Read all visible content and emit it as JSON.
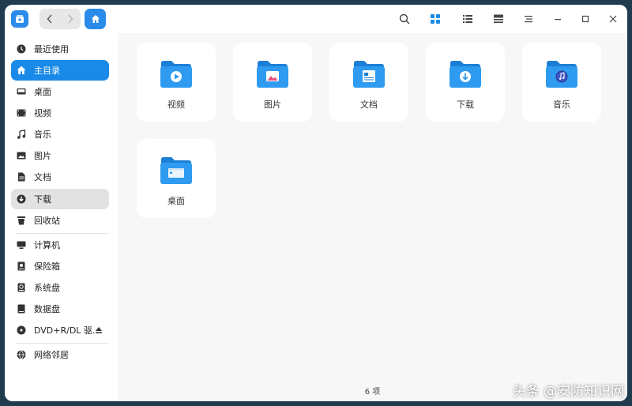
{
  "titlebar": {
    "icons": [
      "back-icon",
      "forward-icon",
      "home-icon",
      "search-icon",
      "icon-view-icon",
      "list-view-icon",
      "detail-view-icon",
      "menu-icon",
      "minimize-icon",
      "maximize-icon",
      "close-icon"
    ]
  },
  "sidebar": {
    "items": [
      {
        "label": "最近使用",
        "icon": "clock-icon"
      },
      {
        "label": "主目录",
        "icon": "home-icon"
      },
      {
        "label": "桌面",
        "icon": "desktop-icon"
      },
      {
        "label": "视频",
        "icon": "video-icon"
      },
      {
        "label": "音乐",
        "icon": "music-icon"
      },
      {
        "label": "图片",
        "icon": "picture-icon"
      },
      {
        "label": "文档",
        "icon": "document-icon"
      },
      {
        "label": "下载",
        "icon": "download-icon"
      },
      {
        "label": "回收站",
        "icon": "trash-icon"
      },
      {
        "label": "计算机",
        "icon": "computer-icon"
      },
      {
        "label": "保险箱",
        "icon": "vault-icon"
      },
      {
        "label": "系统盘",
        "icon": "disk-icon"
      },
      {
        "label": "数据盘",
        "icon": "disk-icon"
      },
      {
        "label": "DVD+R/DL 驱…",
        "icon": "optical-drive-icon"
      },
      {
        "label": "网络邻居",
        "icon": "network-icon"
      }
    ]
  },
  "folders": [
    {
      "label": "视频",
      "emblem": "video-icon"
    },
    {
      "label": "图片",
      "emblem": "picture-icon"
    },
    {
      "label": "文档",
      "emblem": "document-icon"
    },
    {
      "label": "下载",
      "emblem": "download-icon"
    },
    {
      "label": "音乐",
      "emblem": "music-icon"
    },
    {
      "label": "桌面",
      "emblem": "desktop-icon"
    }
  ],
  "status": {
    "count": "6 项"
  },
  "watermark": "头条 @安防知识网",
  "colors": {
    "accent": "#1a8ae8",
    "folder": "#2e9bf0",
    "folder_tab": "#1c7fd6"
  }
}
